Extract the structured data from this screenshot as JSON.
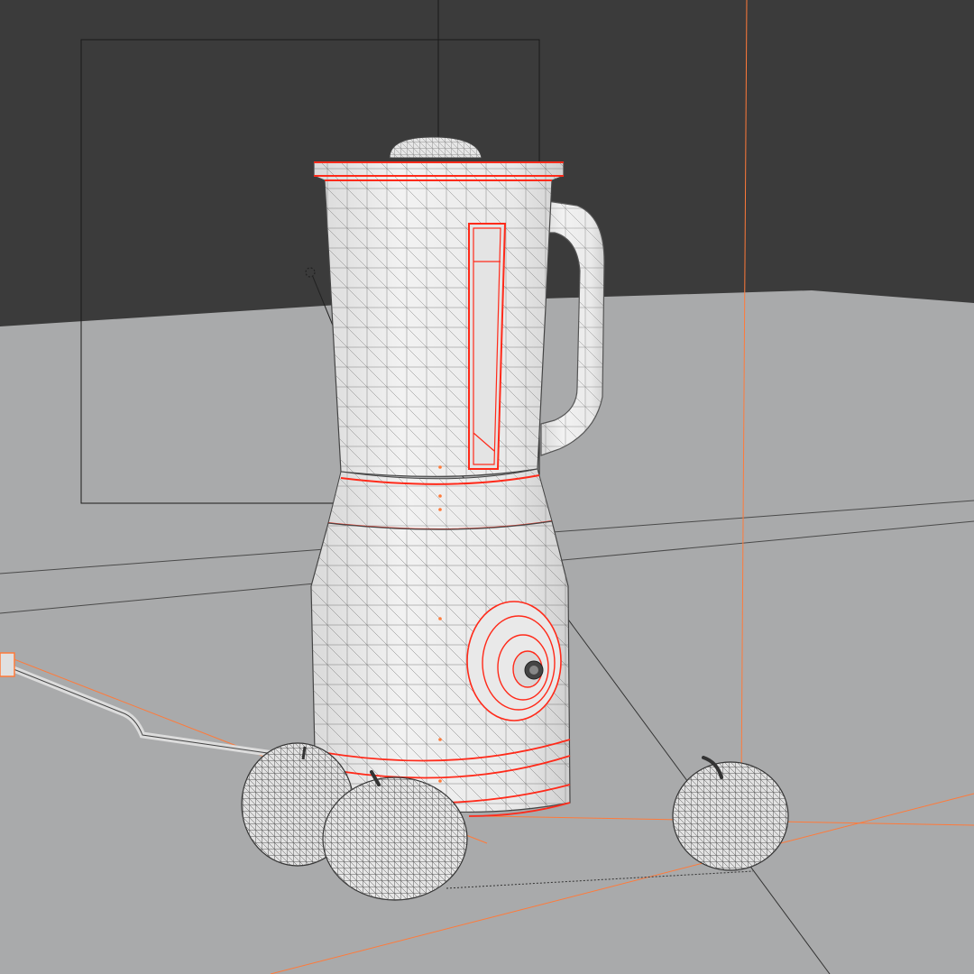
{
  "viewport": {
    "colors": {
      "wall": "#3b3b3b",
      "floor": "#a9aaab",
      "model_fill": "#ececec",
      "wire": "#5a5a5a",
      "selection_edge": "#ff2a1a",
      "guide_line": "#ff7a3a",
      "camera_frame": "#1a1a1a",
      "fruit_fill": "#e2e2e2"
    },
    "objects": [
      {
        "name": "blender-jar",
        "icon": "mesh-icon",
        "selected_edges": true
      },
      {
        "name": "blender-base",
        "icon": "mesh-icon",
        "selected_edges": true
      },
      {
        "name": "blender-dial",
        "icon": "mesh-icon",
        "selected_edges": true
      },
      {
        "name": "power-cord",
        "icon": "curve-icon",
        "selected_edges": false
      },
      {
        "name": "apple-left",
        "icon": "mesh-icon",
        "selected_edges": false
      },
      {
        "name": "apple-front",
        "icon": "mesh-icon",
        "selected_edges": false
      },
      {
        "name": "apple-right",
        "icon": "mesh-icon",
        "selected_edges": false
      }
    ],
    "helpers": [
      "camera-frame",
      "light-icon",
      "vertical-guide"
    ]
  }
}
